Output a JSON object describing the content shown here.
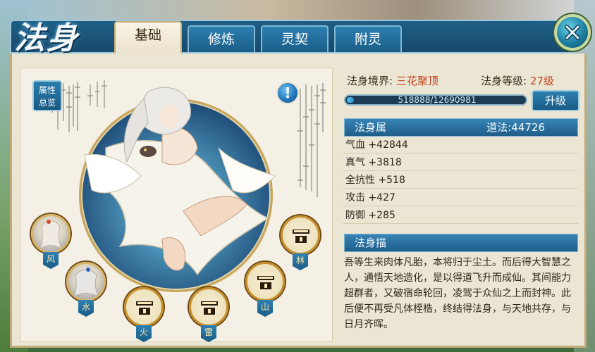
{
  "window": {
    "title": "法身"
  },
  "tabs": [
    {
      "label": "基础",
      "active": true
    },
    {
      "label": "修炼",
      "active": false
    },
    {
      "label": "灵契",
      "active": false
    },
    {
      "label": "附灵",
      "active": false
    }
  ],
  "portrait": {
    "attr_button_line1": "属性",
    "attr_button_line2": "总览",
    "info_button": "!"
  },
  "slots": [
    {
      "label": "风",
      "state": "hero"
    },
    {
      "label": "水",
      "state": "hero"
    },
    {
      "label": "火",
      "state": "locked"
    },
    {
      "label": "雷",
      "state": "locked"
    },
    {
      "label": "山",
      "state": "locked"
    },
    {
      "label": "林",
      "state": "locked"
    }
  ],
  "status": {
    "realm_label": "法身境界:",
    "realm_value": "三花聚顶",
    "level_label": "法身等级:",
    "level_value": "27级",
    "exp_text": "518888/12690981",
    "exp_fraction": 0.0409,
    "upgrade_label": "升级"
  },
  "attributes": {
    "header": "法身属",
    "daofa_label": "道法:",
    "daofa_value": "44726",
    "rows": [
      {
        "name": "气血",
        "value": "+42844"
      },
      {
        "name": "真气",
        "value": "+3818"
      },
      {
        "name": "全抗性",
        "value": "+518"
      },
      {
        "name": "攻击",
        "value": "+427"
      },
      {
        "name": "防御",
        "value": "+285"
      }
    ]
  },
  "description": {
    "header": "法身描",
    "text": "吾等生来肉体凡胎，本将归于尘土。而后得大智慧之人，通悟天地造化，是以得道飞升而成仙。其间能力超群者，又破宿命轮回，凌驾于众仙之上而封神。此后便不再受凡体桎梏，终结得法身，与天地共存，与日月齐晖。"
  },
  "colors": {
    "accent_blue": "#1e5f86",
    "highlight_red": "#c3421d",
    "panel_bg": "#ebe5d3"
  }
}
